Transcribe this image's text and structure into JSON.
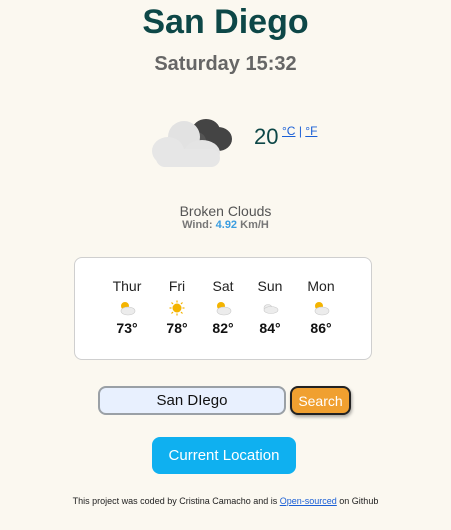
{
  "city": "San Diego",
  "datetime": "Saturday 15:32",
  "current": {
    "temperature": "20",
    "unit_c": "°C",
    "unit_separator": "|",
    "unit_f": "°F",
    "description": "Broken Clouds",
    "wind_label": "Wind:",
    "wind_speed": "4.92",
    "wind_unit": "Km/H",
    "icon": "broken-clouds-icon"
  },
  "forecast": [
    {
      "day": "Thur",
      "temp": "73°",
      "icon": "partly-cloudy-icon"
    },
    {
      "day": "Fri",
      "temp": "78°",
      "icon": "sun-icon"
    },
    {
      "day": "Sat",
      "temp": "82°",
      "icon": "partly-cloudy-icon"
    },
    {
      "day": "Sun",
      "temp": "84°",
      "icon": "cloud-icon"
    },
    {
      "day": "Mon",
      "temp": "86°",
      "icon": "partly-cloudy-icon"
    }
  ],
  "search": {
    "value": "San DIego",
    "button_label": "Search"
  },
  "current_location_label": "Current Location",
  "footer": {
    "text_before": "This project was coded by Cristina Camacho and is ",
    "link_text": "Open-sourced",
    "text_after": " on Github"
  },
  "colors": {
    "title": "#0d4747",
    "search_button": "#f0a030",
    "location_button": "#0fb0f0",
    "wind_speed": "#3a9de0",
    "background": "#fbf8f0"
  }
}
